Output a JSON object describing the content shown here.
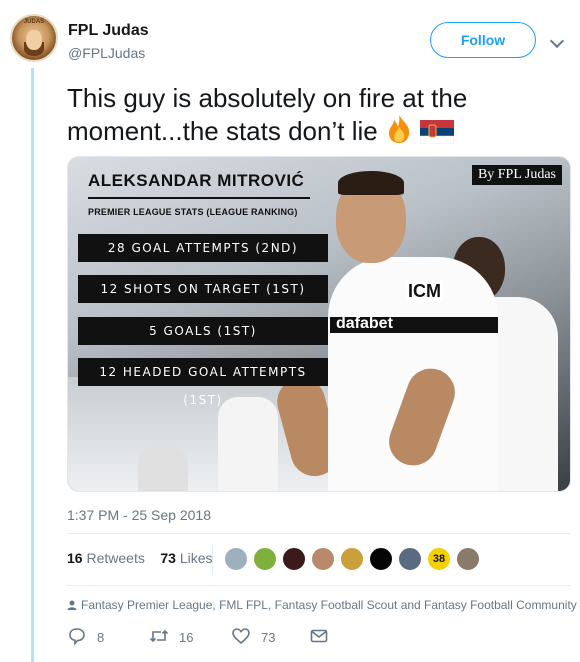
{
  "author": {
    "name": "FPL Judas",
    "handle": "@FPLJudas",
    "avatar_label": "JUDAS"
  },
  "follow_label": "Follow",
  "tweet": {
    "text": "This guy is absolutely on fire at the moment...the stats don’t lie",
    "emojis": [
      "fire-emoji",
      "serbia-flag-emoji"
    ]
  },
  "media": {
    "by_tag": "By FPL Judas",
    "title": "ALEKSANDAR MITROVIĆ",
    "subtitle": "PREMIER LEAGUE STATS (LEAGUE RANKING)",
    "stats": [
      "28 GOAL ATTEMPTS (2ND)",
      "12 SHOTS ON TARGET (1ST)",
      "5 GOALS (1ST)",
      "12 HEADED GOAL ATTEMPTS (1ST)"
    ],
    "sponsor": "dafabet",
    "sponsor2": "dafabet",
    "shirt_text": "ICM"
  },
  "timestamp": "1:37 PM - 25 Sep 2018",
  "engagement": {
    "retweets_count": "16",
    "retweets_label": "Retweets",
    "likes_count": "73",
    "likes_label": "Likes",
    "liker_badge": "38"
  },
  "context": "Fantasy Premier League, FML FPL, Fantasy Football Scout and Fantasy Football Community",
  "actions": {
    "replies": "8",
    "retweets": "16",
    "likes": "73"
  },
  "colors": {
    "accent": "#1da1f2",
    "thread_line": "#b3e1f6",
    "muted": "#657786"
  }
}
